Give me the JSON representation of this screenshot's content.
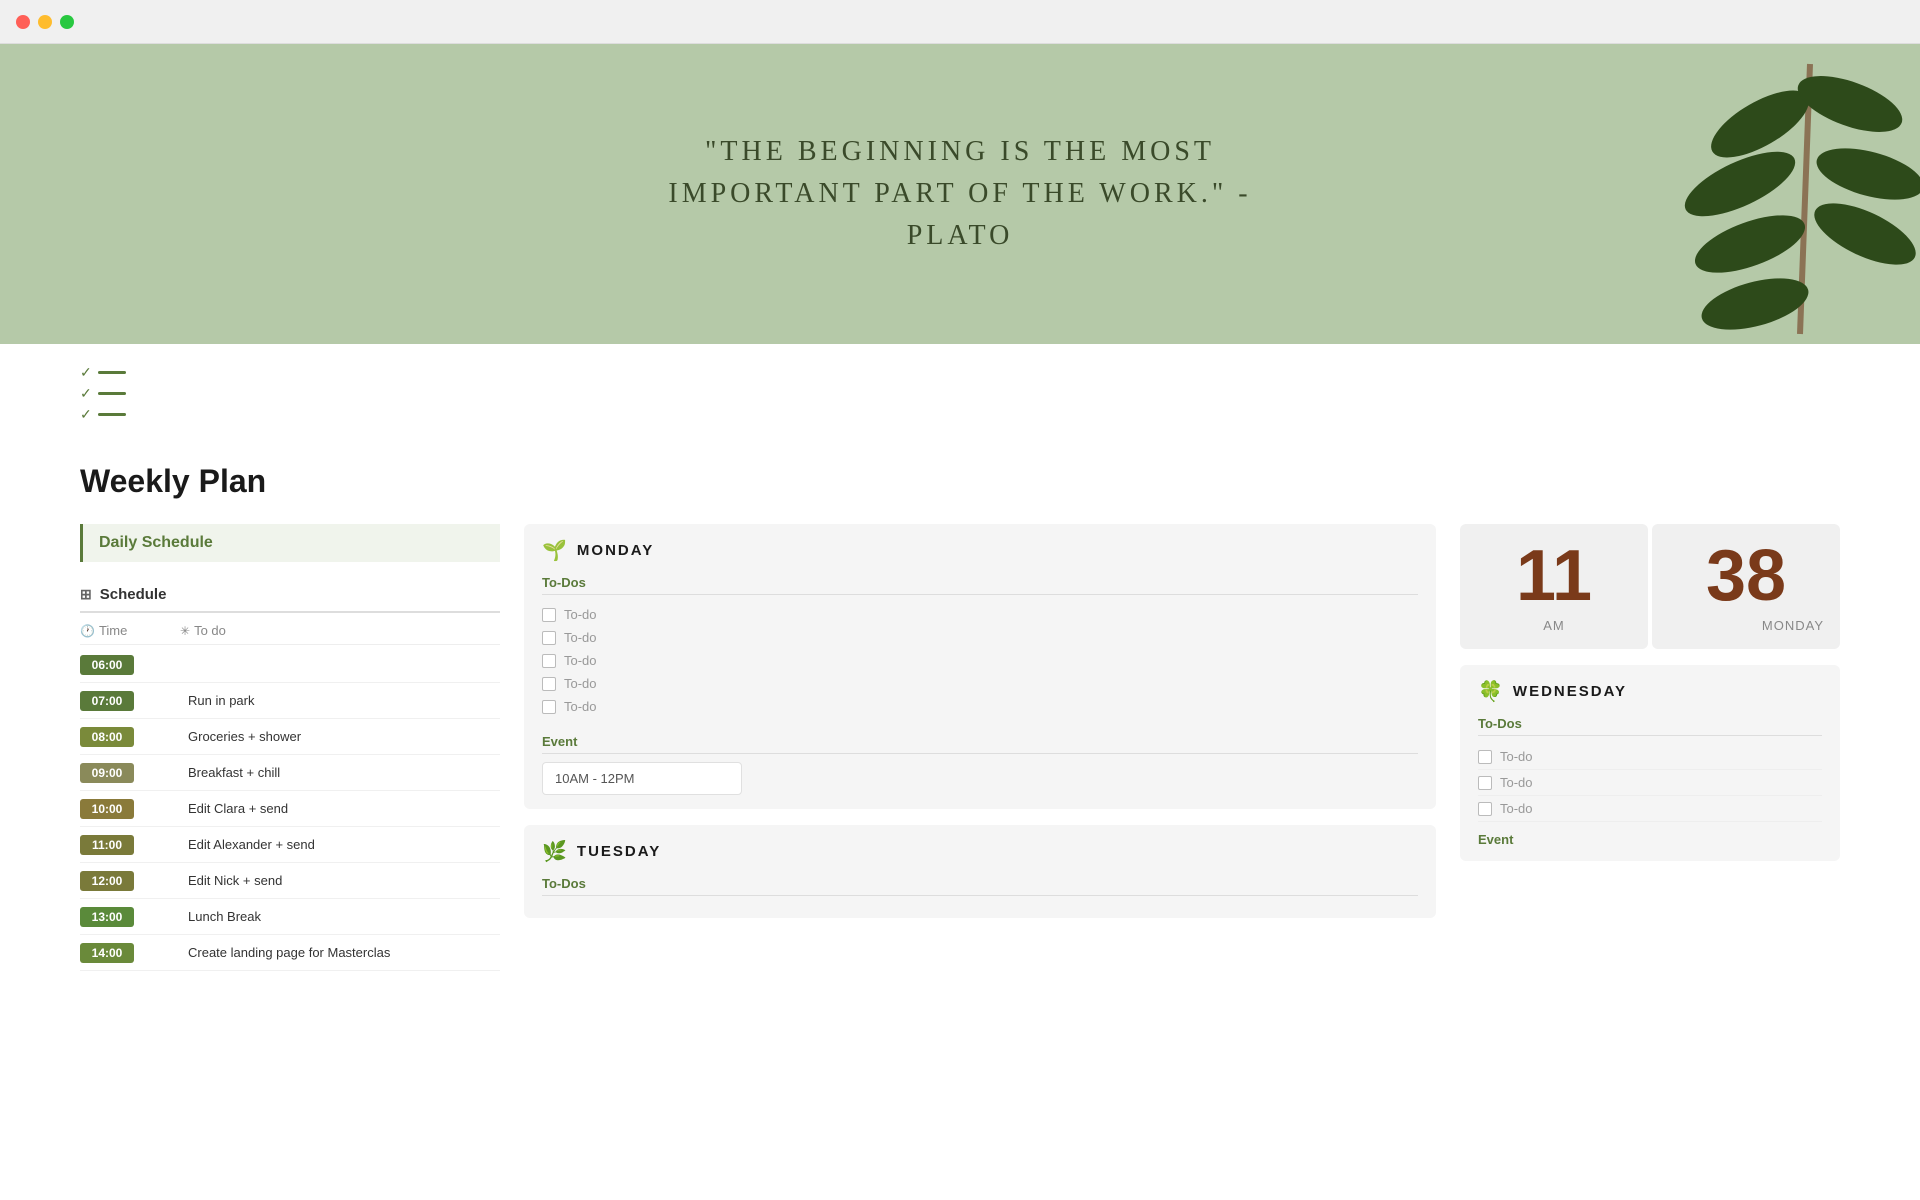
{
  "browser": {
    "traffic_lights": [
      "red",
      "yellow",
      "green"
    ]
  },
  "hero": {
    "quote": "\"The Beginning is the most important part of the work.\" - Plato",
    "bg_color": "#b5c9a8"
  },
  "page_title": "Weekly Plan",
  "left_column": {
    "daily_schedule_label": "Daily Schedule",
    "table_label": "Schedule",
    "col_time": "Time",
    "col_todo": "To do",
    "rows": [
      {
        "time": "06:00",
        "task": "",
        "color": "#5a7a3a"
      },
      {
        "time": "07:00",
        "task": "Run in park",
        "color": "#5a7a3a"
      },
      {
        "time": "08:00",
        "task": "Groceries + shower",
        "color": "#7a8a3a"
      },
      {
        "time": "09:00",
        "task": "Breakfast + chill",
        "color": "#8a8a5a"
      },
      {
        "time": "10:00",
        "task": "Edit Clara + send",
        "color": "#8a7a3a"
      },
      {
        "time": "11:00",
        "task": "Edit Alexander + send",
        "color": "#7a7a3a"
      },
      {
        "time": "12:00",
        "task": "Edit Nick + send",
        "color": "#7a7a3a"
      },
      {
        "time": "13:00",
        "task": "Lunch Break",
        "color": "#5a8a3a"
      },
      {
        "time": "14:00",
        "task": "Create landing page for Masterclas",
        "color": "#6a8a3a"
      }
    ]
  },
  "monday": {
    "icon": "🌱",
    "name": "MONDAY",
    "todos_label": "To-Dos",
    "todos": [
      "To-do",
      "To-do",
      "To-do",
      "To-do",
      "To-do"
    ],
    "event_label": "Event",
    "event_time": "10AM - 12PM"
  },
  "tuesday": {
    "icon": "🌿",
    "name": "TUESDAY",
    "todos_label": "To-Dos"
  },
  "clock": {
    "hour": "11",
    "minute": "38",
    "am_pm": "AM",
    "day": "MONDAY"
  },
  "wednesday": {
    "icon": "🍀",
    "name": "WEDNESDAY",
    "todos_label": "To-Dos",
    "todos": [
      "To-do",
      "To-do",
      "To-do"
    ],
    "event_label": "Event"
  }
}
